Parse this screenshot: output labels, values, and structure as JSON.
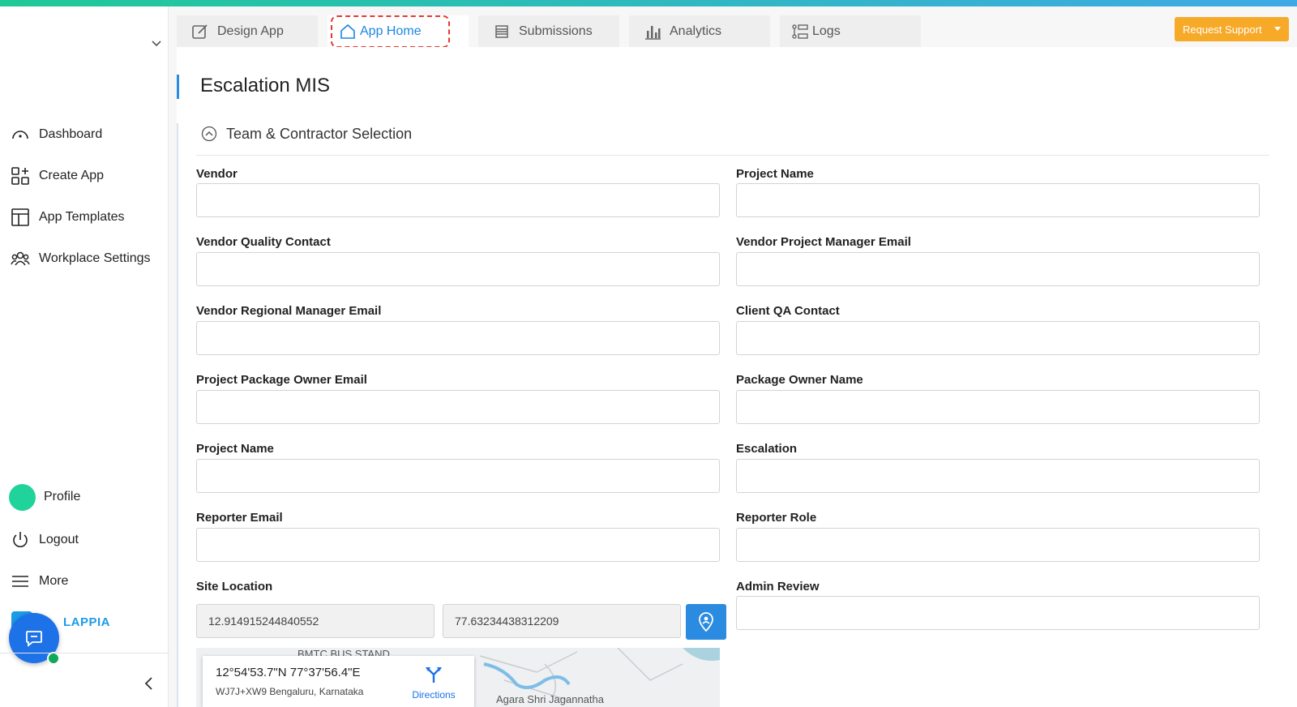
{
  "sidebar": {
    "items": [
      {
        "label": "Dashboard",
        "icon": "dashboard-gauge-icon"
      },
      {
        "label": "Create App",
        "icon": "create-app-grid-icon"
      },
      {
        "label": "App Templates",
        "icon": "app-templates-layout-icon"
      },
      {
        "label": "Workplace Settings",
        "icon": "users-group-icon"
      }
    ],
    "profile_label": "Profile",
    "logout_label": "Logout",
    "more_label": "More",
    "brand_text": "LAPPIA"
  },
  "tabs": [
    {
      "label": "Design App",
      "icon": "edit-icon"
    },
    {
      "label": "App Home",
      "icon": "home-icon",
      "active": true
    },
    {
      "label": "Submissions",
      "icon": "list-icon"
    },
    {
      "label": "Analytics",
      "icon": "bar-chart-icon"
    },
    {
      "label": "Logs",
      "icon": "logs-icon"
    }
  ],
  "support_button": "Request Support",
  "form": {
    "title": "Escalation MIS",
    "section": "Team & Contractor Selection",
    "fields_left": [
      {
        "label": "Vendor",
        "value": ""
      },
      {
        "label": "Vendor Quality Contact",
        "value": ""
      },
      {
        "label": "Vendor Regional Manager Email",
        "value": ""
      },
      {
        "label": "Project Package Owner Email",
        "value": ""
      },
      {
        "label": "Project Name",
        "value": ""
      },
      {
        "label": "Reporter Email",
        "value": ""
      }
    ],
    "fields_right": [
      {
        "label": "Project Name",
        "value": ""
      },
      {
        "label": "Vendor Project Manager Email",
        "value": ""
      },
      {
        "label": "Client QA Contact",
        "value": ""
      },
      {
        "label": "Package Owner Name",
        "value": ""
      },
      {
        "label": "Escalation",
        "value": ""
      },
      {
        "label": "Reporter Role",
        "value": ""
      },
      {
        "label": "Admin Review",
        "value": ""
      }
    ],
    "site_location": {
      "label": "Site Location",
      "latitude": "12.914915244840552",
      "longitude": "77.63234438312209"
    }
  },
  "map": {
    "coords_text": "12°54'53.7\"N 77°37'56.4\"E",
    "plus_code": "WJ7J+XW9 Bengaluru, Karnataka",
    "directions_label": "Directions",
    "place_label_1": "BMTC BUS STAND",
    "place_label_2": "Agara Shri Jagannatha"
  },
  "colors": {
    "accent": "#2a8be0",
    "support": "#f7a928",
    "avatar": "#1fd39a",
    "active_outline": "#e53935"
  }
}
